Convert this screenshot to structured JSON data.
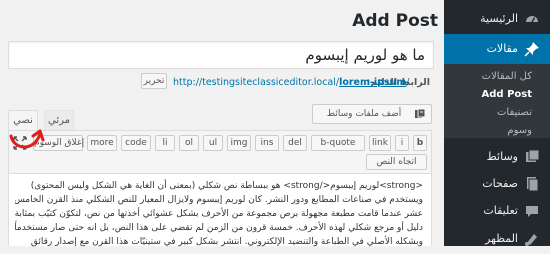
{
  "page": {
    "title": "Add Post"
  },
  "post": {
    "title": "ما هو لوريم إيبسوم"
  },
  "permalink": {
    "label": "الرابط الدائم:",
    "url_base": "http://testingsiteclassiceditor.local/",
    "url_slug": "lorem-ipsum",
    "url_tail": "/",
    "edit_label": "تحرير"
  },
  "media": {
    "add_label": "أضف ملفات وسائط",
    "icon": "media-icon"
  },
  "tabs": {
    "visual": "مرئي",
    "text": "نصي"
  },
  "toolbar": {
    "row1": [
      "b",
      "i",
      "link",
      "b-quote",
      "del",
      "ins",
      "img",
      "ul",
      "ol",
      "li",
      "code",
      "more",
      "إغلاق الوسوم"
    ],
    "text_direction": "اتجاه النص"
  },
  "content": {
    "lines": [
      "<strong>لوريم إيبسوم</strong> هو ببساطة نص شكلي (بمعنى أن الغاية هي الشكل وليس المحتوى)",
      "ويستخدم في صناعات المطابع ودور النشر. كان لوريم إيبسوم ولايزال المعيار للنص الشكلي منذ القرن الخامس",
      "عشر عندما قامت مطبعة مجهولة برص مجموعة من الأحرف بشكل عشوائي أخذتها من نص، لتكوّن كتيّب بمثابة",
      "دليل أو مرجع شكلي لهذه الأحرف. خمسة قرون من الزمن لم تقضي على هذا النص، بل انه حتى صار مستخدماً",
      "وبشكله الأصلي في الطباعة والتنضيد الإلكتروني. انتشر بشكل كبير في ستينيّات هذا القرن مع إصدار رقائق"
    ]
  },
  "sidebar": {
    "items": [
      {
        "label": "الرئيسية",
        "icon": "dashboard-icon"
      },
      {
        "label": "مقالات",
        "icon": "pin-icon",
        "active": true
      },
      {
        "label": "وسائط",
        "icon": "media-icon"
      },
      {
        "label": "صفحات",
        "icon": "pages-icon"
      },
      {
        "label": "تعليقات",
        "icon": "comments-icon"
      },
      {
        "label": "المظهر",
        "icon": "appearance-icon"
      }
    ],
    "submenu": [
      "كل المقالات",
      "Add Post",
      "تصنيفات",
      "وسوم"
    ]
  },
  "colors": {
    "accent": "#0073aa",
    "sidebar": "#23282d",
    "annotation": "#e01e1e"
  }
}
